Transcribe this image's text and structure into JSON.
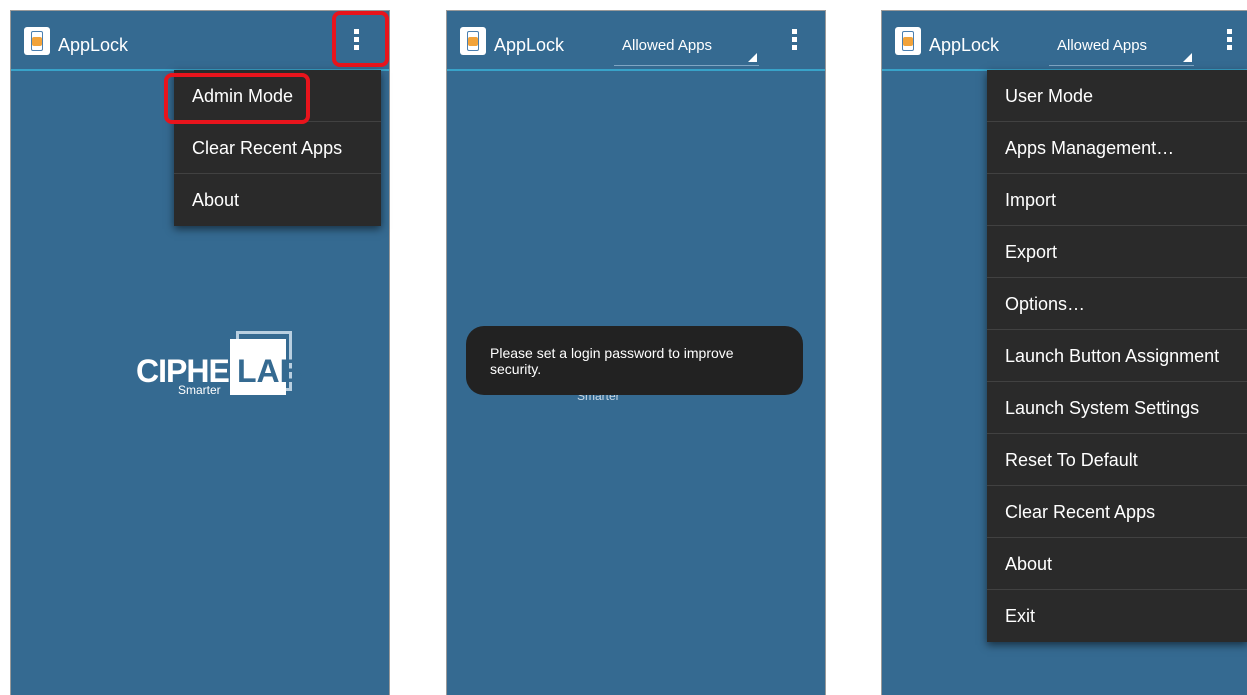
{
  "panel1": {
    "app_title": "AppLock",
    "menu": [
      "Admin Mode",
      "Clear Recent Apps",
      "About"
    ],
    "logo": {
      "cipher": "CIPHER",
      "lab": "LAB",
      "tagline": "Smarter"
    }
  },
  "panel2": {
    "app_title": "AppLock",
    "spinner": "Allowed Apps",
    "toast": "Please set a login password to improve security.",
    "logo_tagline": "Smarter"
  },
  "panel3": {
    "app_title": "AppLock",
    "spinner": "Allowed Apps",
    "menu": [
      "User Mode",
      "Apps Management…",
      "Import",
      "Export",
      "Options…",
      "Launch Button Assignment",
      "Launch System Settings",
      "Reset To Default",
      "Clear Recent Apps",
      "About",
      "Exit"
    ]
  },
  "colors": {
    "screen_bg": "#356a91",
    "action_bar_divider": "#38a3c9",
    "menu_bg": "#2a2a2a",
    "highlight": "#e8141c",
    "toast_bg": "#222222"
  },
  "icons": [
    "applock-icon",
    "overflow-menu-icon",
    "spinner-dropdown-icon"
  ]
}
